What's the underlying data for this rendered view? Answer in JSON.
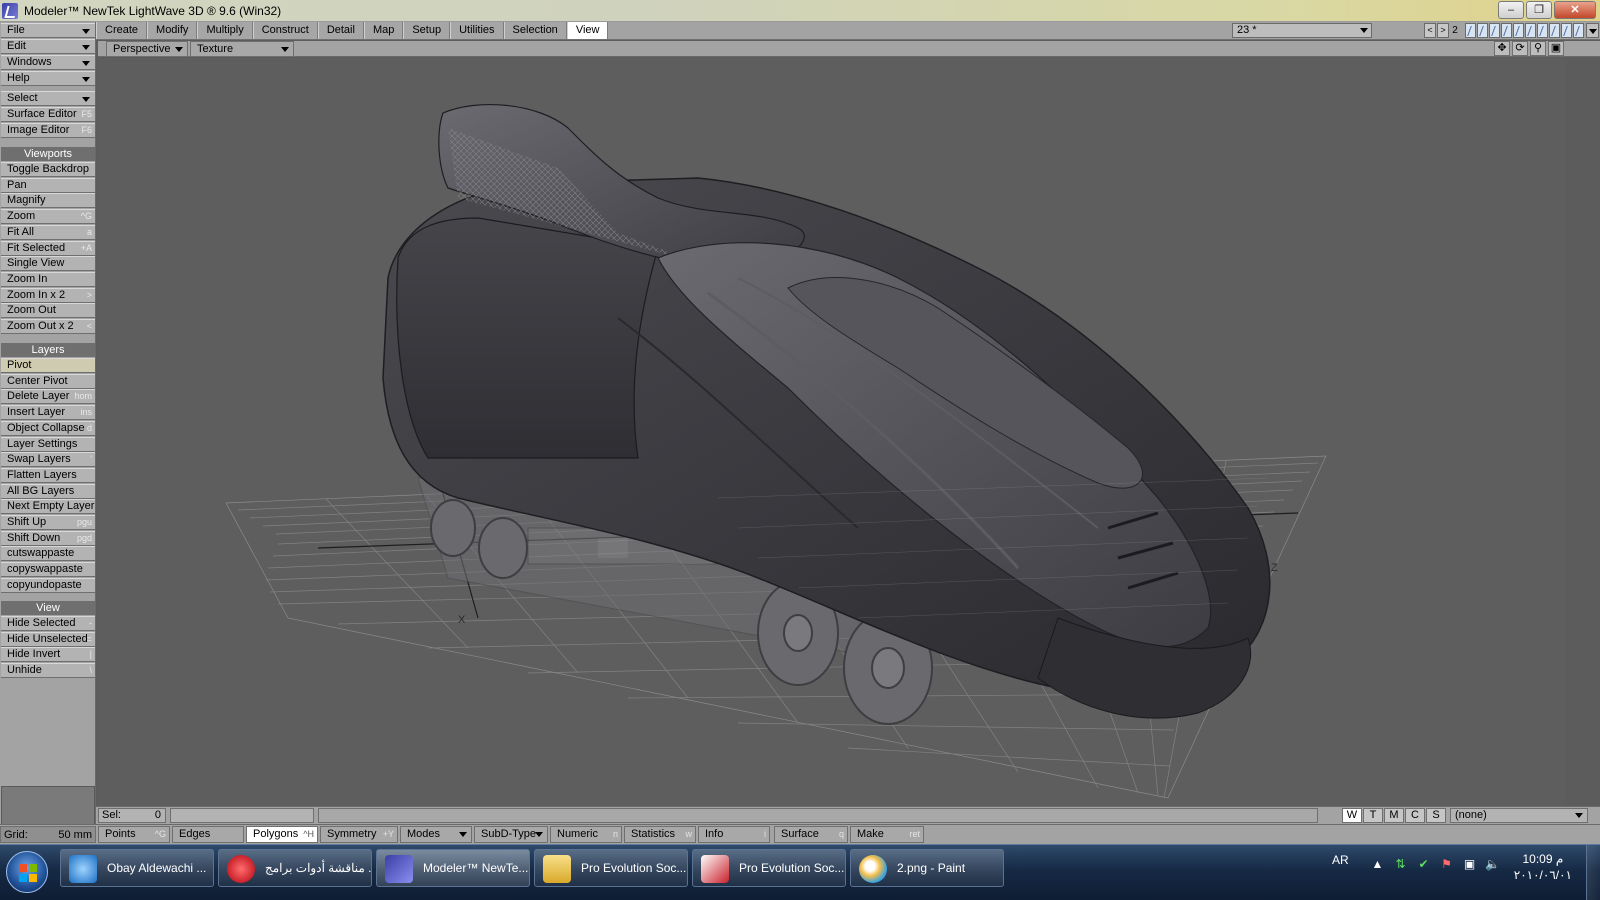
{
  "title_bar": {
    "title": "Modeler™ NewTek LightWave 3D ® 9.6  (Win32)"
  },
  "tabs": [
    "Create",
    "Modify",
    "Multiply",
    "Construct",
    "Detail",
    "Map",
    "Setup",
    "Utilities",
    "Selection",
    "View"
  ],
  "active_tab": "View",
  "layer_select": {
    "value": "23 *"
  },
  "layer_nav": {
    "current_bank": "2"
  },
  "menus": {
    "file": "File",
    "edit": "Edit",
    "windows": "Windows",
    "help": "Help",
    "select": "Select",
    "surface_editor": "Surface Editor",
    "surface_editor_sc": "F5",
    "image_editor": "Image Editor",
    "image_editor_sc": "F6"
  },
  "viewports_group": {
    "header": "Viewports",
    "items": [
      {
        "label": "Toggle Backdrop",
        "sc": ""
      },
      {
        "label": "Pan",
        "sc": ""
      },
      {
        "label": "Magnify",
        "sc": ""
      },
      {
        "label": "Zoom",
        "sc": "^G"
      },
      {
        "label": "Fit All",
        "sc": "a"
      },
      {
        "label": "Fit Selected",
        "sc": "+A"
      },
      {
        "label": "Single View",
        "sc": ""
      },
      {
        "label": "Zoom In",
        "sc": ""
      },
      {
        "label": "Zoom In x 2",
        "sc": ">"
      },
      {
        "label": "Zoom Out",
        "sc": ""
      },
      {
        "label": "Zoom Out x 2",
        "sc": "<"
      }
    ]
  },
  "layers_group": {
    "header": "Layers",
    "items": [
      {
        "label": "Pivot",
        "sc": ""
      },
      {
        "label": "Center Pivot",
        "sc": ""
      },
      {
        "label": "Delete Layer",
        "sc": "hom"
      },
      {
        "label": "Insert Layer",
        "sc": "ins"
      },
      {
        "label": "Object Collapse",
        "sc": "d"
      },
      {
        "label": "Layer Settings",
        "sc": ""
      },
      {
        "label": "Swap Layers",
        "sc": "'"
      },
      {
        "label": "Flatten Layers",
        "sc": ""
      },
      {
        "label": "All BG Layers",
        "sc": ""
      },
      {
        "label": "Next Empty Layer",
        "sc": ""
      },
      {
        "label": "Shift Up",
        "sc": "pgu"
      },
      {
        "label": "Shift Down",
        "sc": "pgd"
      },
      {
        "label": "cutswappaste",
        "sc": ""
      },
      {
        "label": "copyswappaste",
        "sc": ""
      },
      {
        "label": "copyundopaste",
        "sc": ""
      }
    ]
  },
  "view_group": {
    "header": "View",
    "items": [
      {
        "label": "Hide Selected",
        "sc": "-"
      },
      {
        "label": "Hide Unselected",
        "sc": "="
      },
      {
        "label": "Hide Invert",
        "sc": "|"
      },
      {
        "label": "Unhide",
        "sc": "\\"
      }
    ]
  },
  "viewport": {
    "projection": "Perspective",
    "render_mode": "Texture",
    "axis_labels": {
      "x": "X",
      "z": "Z"
    }
  },
  "status": {
    "sel_label": "Sel:",
    "sel_value": "0",
    "wtmcs": [
      "W",
      "T",
      "M",
      "C",
      "S"
    ],
    "wtmcs_active": "W",
    "surface_select": "(none)"
  },
  "bottom": {
    "grid_label": "Grid:",
    "grid_value": "50 mm",
    "points": "Points",
    "points_sc": "^G",
    "edges": "Edges",
    "polygons": "Polygons",
    "polygons_sc": "^H",
    "symmetry": "Symmetry",
    "symmetry_sc": "+Y",
    "modes": "Modes",
    "subd": "SubD-Type",
    "numeric": "Numeric",
    "numeric_sc": "n",
    "statistics": "Statistics",
    "statistics_sc": "w",
    "info": "Info",
    "info_sc": "i",
    "surface": "Surface",
    "surface_sc": "q",
    "make": "Make",
    "make_sc": "ret"
  },
  "taskbar": {
    "items": [
      {
        "label": "Obay Aldewachi ...",
        "icon": "internet-explorer-icon"
      },
      {
        "label": "مناقشة أدوات برامج ...",
        "icon": "opera-icon"
      },
      {
        "label": "Modeler™ NewTe...",
        "icon": "lightwave-icon"
      },
      {
        "label": "Pro Evolution Soc...",
        "icon": "folder-icon"
      },
      {
        "label": "Pro Evolution Soc...",
        "icon": "pes-icon"
      },
      {
        "label": "2.png - Paint",
        "icon": "paint-icon"
      }
    ],
    "lang": "AR",
    "time": "10:09 م",
    "date": "٢٠١٠/٠٦/٠١"
  },
  "colors": {
    "panel": "#a3a3a3",
    "viewport_bg": "#5e5e5e",
    "taskbar": "#162a45",
    "active_tab": "#ffffff"
  }
}
